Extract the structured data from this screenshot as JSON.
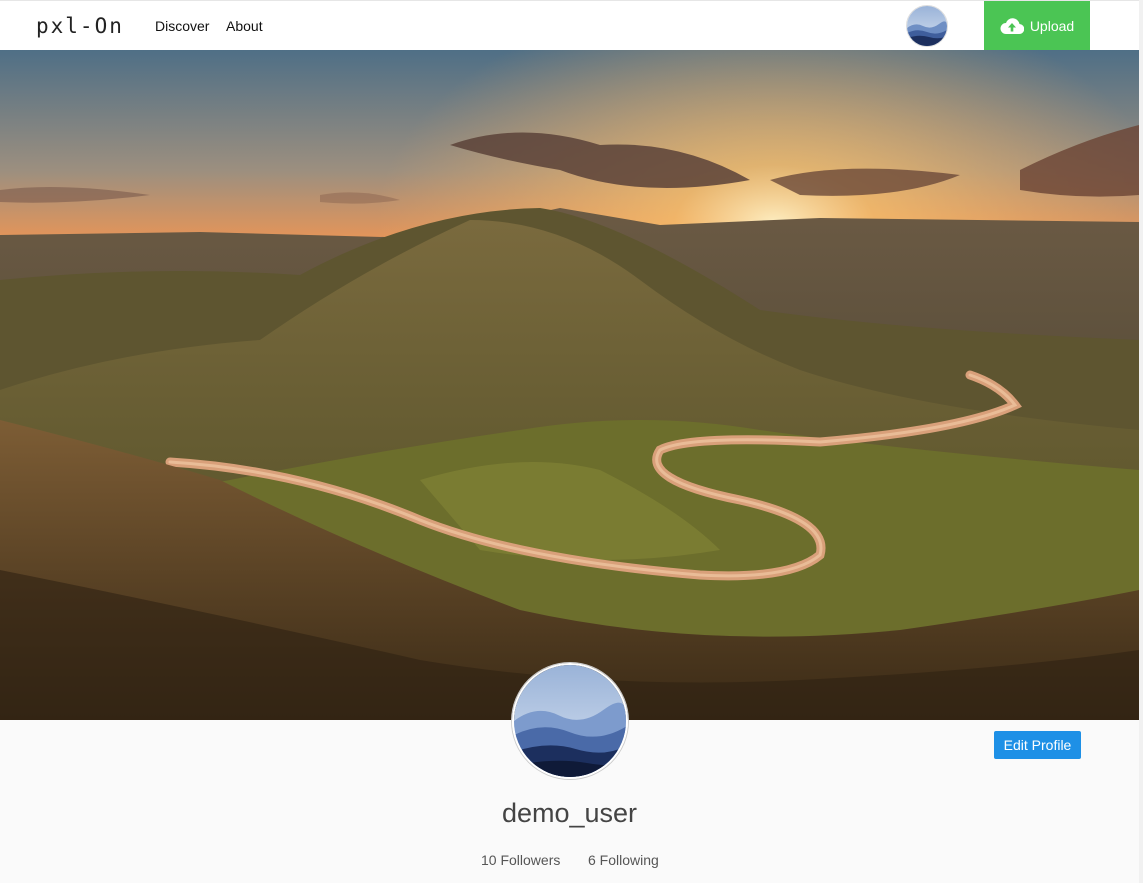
{
  "navbar": {
    "brand": "pxl-On",
    "links": [
      {
        "label": "Discover"
      },
      {
        "label": "About"
      }
    ],
    "upload_label": "Upload",
    "upload_icon": "cloud-upload-icon",
    "upload_color": "#4bc554"
  },
  "cover": {
    "image": "sunset-winding-road-hills"
  },
  "profile": {
    "username": "demo_user",
    "edit_label": "Edit Profile",
    "edit_color": "#1e90e6",
    "followers": "10 Followers",
    "following": "6 Following"
  }
}
